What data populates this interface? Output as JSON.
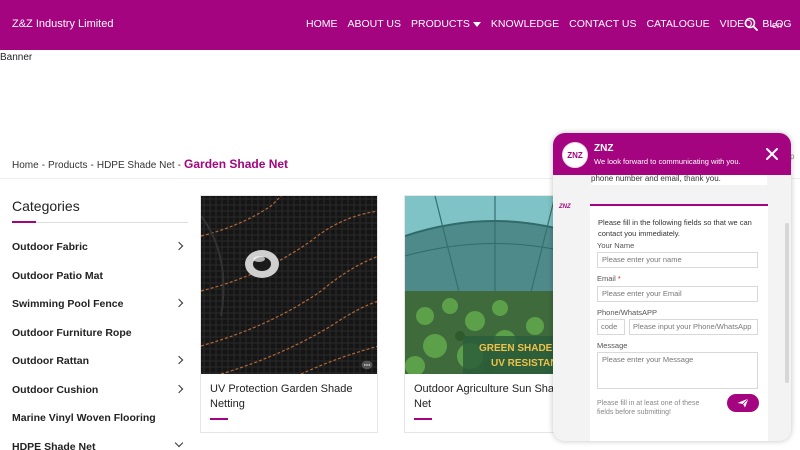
{
  "header": {
    "logo_text": "Z&Z Industry Limited",
    "nav": [
      {
        "label": "HOME"
      },
      {
        "label": "ABOUT US"
      },
      {
        "label": "PRODUCTS",
        "dropdown": true
      },
      {
        "label": "KNOWLEDGE"
      },
      {
        "label": "CONTACT US"
      },
      {
        "label": "CATALOGUE"
      },
      {
        "label": "VIDEO"
      },
      {
        "label": "BLOG"
      }
    ],
    "search_icon": "search-icon",
    "language": "en"
  },
  "banner": {
    "text": "Banner"
  },
  "breadcrumb": {
    "items": [
      "Home",
      "Products",
      "HDPE Shade Net"
    ],
    "separator": "-",
    "current": "Garden Shade Net"
  },
  "sidebar": {
    "title": "Categories",
    "items": [
      {
        "label": "Outdoor Fabric",
        "expand": "right"
      },
      {
        "label": "Outdoor Patio Mat",
        "expand": ""
      },
      {
        "label": "Swimming Pool Fence",
        "expand": "right"
      },
      {
        "label": "Outdoor Furniture Rope",
        "expand": ""
      },
      {
        "label": "Outdoor Rattan",
        "expand": "right"
      },
      {
        "label": "Outdoor Cushion",
        "expand": "right"
      },
      {
        "label": "Marine Vinyl Woven Flooring",
        "expand": ""
      },
      {
        "label": "HDPE Shade Net",
        "expand": "down"
      }
    ]
  },
  "products": [
    {
      "title": "UV Protection Garden Shade Netting"
    },
    {
      "title": "Outdoor Agriculture Sun Shade Net",
      "image_text_1": "GREEN SHADE CLO",
      "image_text_2": "UV RESISTANT"
    }
  ],
  "chat": {
    "name": "ZNZ",
    "avatar_text": "ZNZ",
    "subtitle": "We look forward to communicating with you.",
    "previous_message": "phone number and email, thank you.",
    "form_logo": "ZNZ",
    "intro": "Please fill in the following fields so that we can contact you immediately.",
    "fields": {
      "name_label": "Your Name",
      "name_placeholder": "Please enter your name",
      "email_label": "Email",
      "email_required": "*",
      "email_placeholder": "Please enter your Email",
      "phone_label": "Phone/WhatsAPP",
      "code_placeholder": "code",
      "phone_placeholder": "Please input your Phone/WhatsApp",
      "message_label": "Message",
      "message_placeholder": "Please enter your Message"
    },
    "note": "Please fill in at least one of these fields before submitting!",
    "edge_text": "p"
  },
  "colors": {
    "brand": "#a4047f",
    "required": "#e0243b"
  }
}
